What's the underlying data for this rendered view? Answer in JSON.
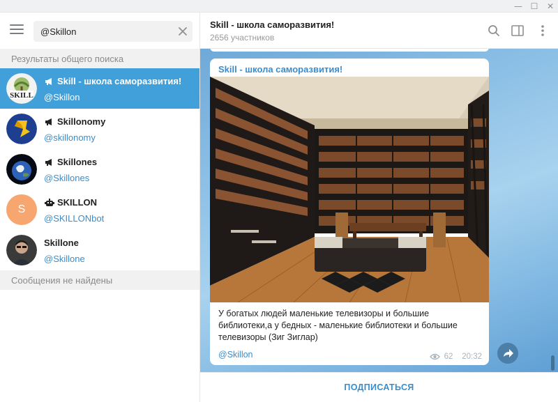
{
  "window": {
    "controls": {
      "minimize": "—",
      "maximize": "☐",
      "close": "✕"
    }
  },
  "search": {
    "value": "@Skillon",
    "icon": "clear-icon"
  },
  "left": {
    "global_results_header": "Результаты общего поиска",
    "results": [
      {
        "title": "Skill - школа саморазвития!",
        "handle": "@Skillon",
        "type_icon": "megaphone-icon",
        "active": true,
        "avatar": "skill-logo"
      },
      {
        "title": "Skillonomy",
        "handle": "@skillonomy",
        "type_icon": "megaphone-icon",
        "active": false,
        "avatar": "s-logo-yellow-blue"
      },
      {
        "title": "Skillones",
        "handle": "@Skillones",
        "type_icon": "megaphone-icon",
        "active": false,
        "avatar": "earth"
      },
      {
        "title": "SKILLON",
        "handle": "@SKILLONbot",
        "type_icon": "bot-icon",
        "active": false,
        "avatar": "S",
        "avatar_color": "#f7a670"
      },
      {
        "title": "Skillone",
        "handle": "@Skillone",
        "type_icon": "",
        "active": false,
        "avatar": "person-photo"
      }
    ],
    "messages_not_found": "Сообщения не найдены"
  },
  "chat": {
    "title": "Skill - школа саморазвития!",
    "subtitle": "2656 участников",
    "post": {
      "author": "Skill - школа саморазвития!",
      "photo": "library-room",
      "text": "У богатых людей маленькие телевизоры и большие библиотеки,а у бедных - маленькие библиотеки и большие телевизоры (Зиг Зиглар)",
      "link": "@Skillon",
      "views": "62",
      "time": "20:32"
    },
    "subscribe_label": "ПОДПИСАТЬСЯ"
  },
  "colors": {
    "accent": "#419fd9",
    "link": "#3a8dca",
    "chat_bg": "#8dc0e6"
  }
}
